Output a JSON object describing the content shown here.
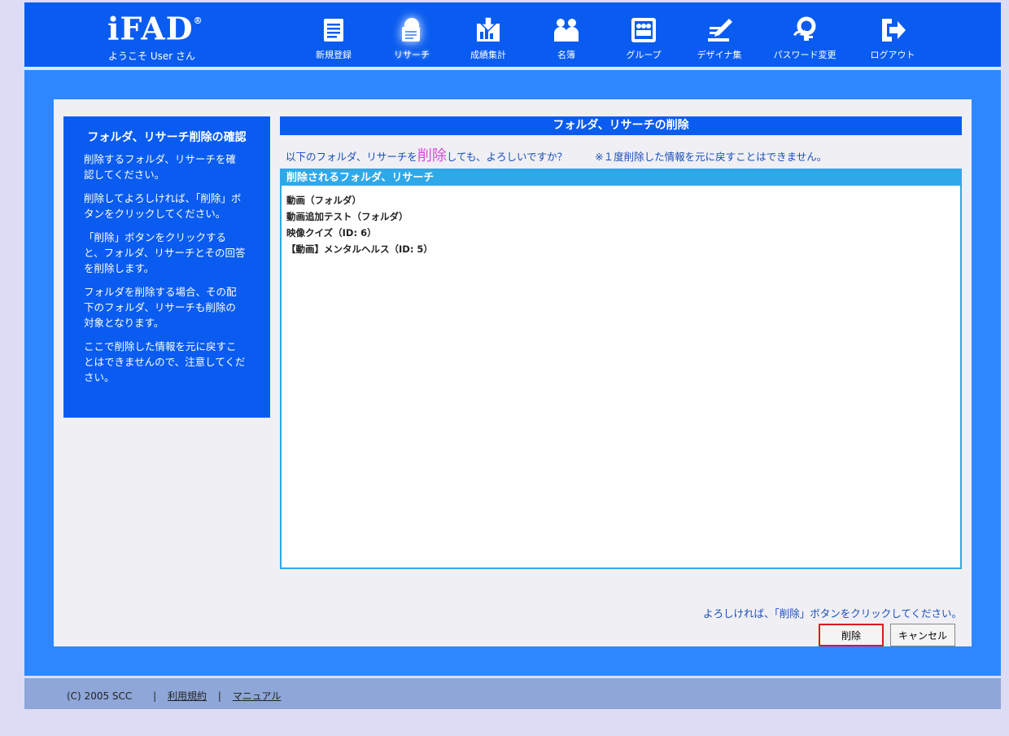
{
  "header": {
    "logo_text": "iFAD",
    "logo_mark": "®",
    "welcome": "ようこそ User さん",
    "nav": [
      {
        "label": "新規登録",
        "icon": "document-icon"
      },
      {
        "label": "リサーチ",
        "icon": "research-icon"
      },
      {
        "label": "成績集計",
        "icon": "download-chart-icon"
      },
      {
        "label": "名簿",
        "icon": "people-icon"
      },
      {
        "label": "グループ",
        "icon": "group-icon"
      },
      {
        "label": "デザイナ集",
        "icon": "pen-icon"
      },
      {
        "label": "パスワード変更",
        "icon": "password-icon"
      },
      {
        "label": "ログアウト",
        "icon": "logout-icon"
      }
    ]
  },
  "sidebar": {
    "title": "フォルダ、リサーチ削除の確認",
    "paragraphs": [
      "削除するフォルダ、リサーチを確認してください。",
      "削除してよろしければ、「削除」ボタンをクリックしてください。",
      "「削除」ボタンをクリックすると、フォルダ、リサーチとその回答を削除します。",
      "フォルダを削除する場合、その配下のフォルダ、リサーチも削除の対象となります。",
      "ここで削除した情報を元に戻すことはできませんので、注意してください。"
    ]
  },
  "content": {
    "title": "フォルダ、リサーチの削除",
    "confirm_pre": "以下のフォルダ、リサーチを",
    "confirm_emph": "削除",
    "confirm_post": "しても、よろしいですか？",
    "confirm_note": "※１度削除した情報を元に戻すことはできません。",
    "list_header": "削除されるフォルダ、リサーチ",
    "items": [
      "動画（フォルダ）",
      "動画追加テスト（フォルダ）",
      "映像クイズ（ID: 6）",
      "【動画】メンタルヘルス（ID: 5）"
    ],
    "instruction": "よろしければ、「削除」ボタンをクリックしてください。",
    "delete_label": "削除",
    "cancel_label": "キャンセル"
  },
  "footer": {
    "copyright": "(C) 2005 SCC",
    "separator": "|",
    "terms": "利用規約",
    "manual": "マニュアル"
  },
  "colors": {
    "header_bg": "#0a5cf0",
    "main_bg": "#2f87ff",
    "panel_bg": "#efeff4",
    "list_accent": "#2fa8e8",
    "emphasis": "#d64bd6",
    "footer_bg": "#8ea6d8"
  }
}
